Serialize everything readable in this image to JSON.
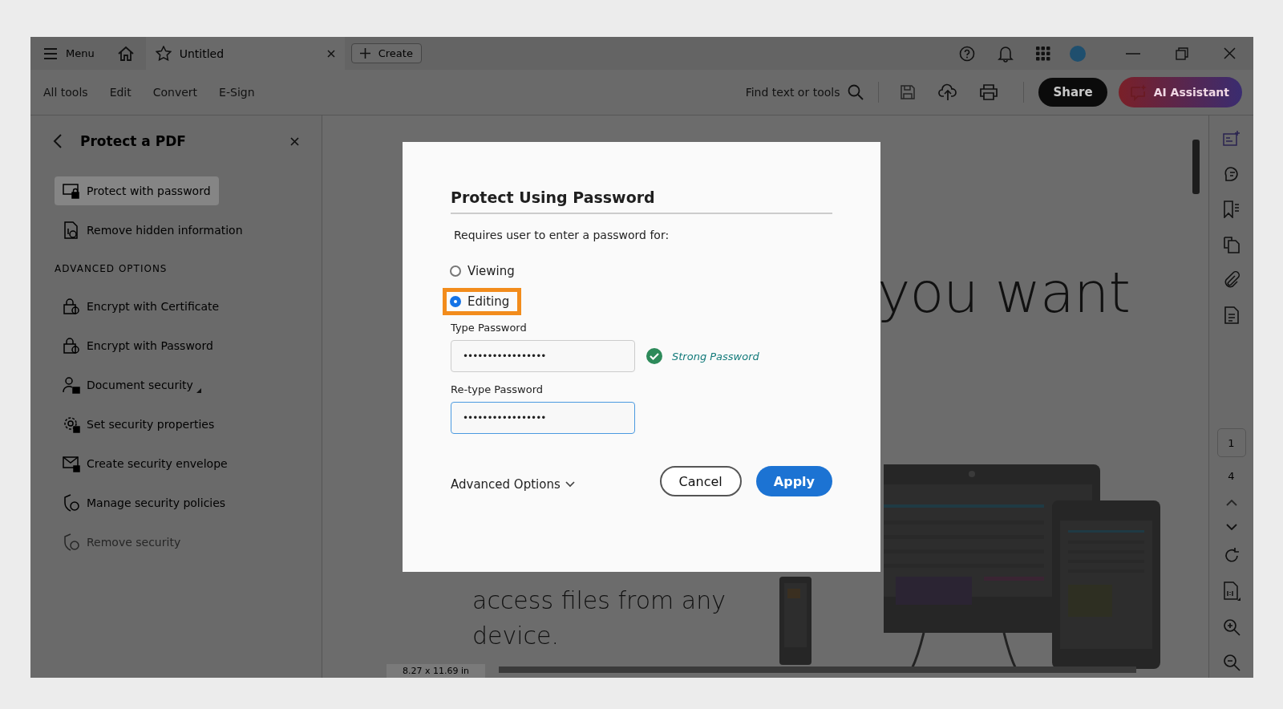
{
  "titlebar": {
    "menu_label": "Menu",
    "tab": {
      "title": "Untitled"
    },
    "create_label": "Create"
  },
  "toolbar": {
    "items": [
      {
        "label": "All tools"
      },
      {
        "label": "Edit"
      },
      {
        "label": "Convert"
      },
      {
        "label": "E-Sign"
      }
    ],
    "search_label": "Find text or tools",
    "share_label": "Share",
    "ai_label": "AI Assistant"
  },
  "sidebar": {
    "title": "Protect a PDF",
    "items": [
      {
        "label": "Protect with password",
        "selected": true,
        "disabled": false,
        "flyout": false
      },
      {
        "label": "Remove hidden information",
        "selected": false,
        "disabled": false,
        "flyout": false
      }
    ],
    "section_heading": "ADVANCED OPTIONS",
    "advanced_items": [
      {
        "label": "Encrypt with Certificate",
        "selected": false,
        "disabled": false,
        "flyout": false
      },
      {
        "label": "Encrypt with Password",
        "selected": false,
        "disabled": false,
        "flyout": false
      },
      {
        "label": "Document security",
        "selected": false,
        "disabled": false,
        "flyout": true
      },
      {
        "label": "Set security properties",
        "selected": false,
        "disabled": false,
        "flyout": false
      },
      {
        "label": "Create security envelope",
        "selected": false,
        "disabled": false,
        "flyout": false
      },
      {
        "label": "Manage security policies",
        "selected": false,
        "disabled": false,
        "flyout": false
      },
      {
        "label": "Remove security",
        "selected": false,
        "disabled": true,
        "flyout": false
      }
    ]
  },
  "document": {
    "heading_fragment": "you want",
    "body_lines": [
      "access files from any",
      "device."
    ],
    "page_size": "8.27 x 11.69 in"
  },
  "right_rail": {
    "page_current": "1",
    "page_total": "4"
  },
  "dialog": {
    "title": "Protect Using Password",
    "prompt": "Requires user to enter a password for:",
    "options": [
      {
        "label": "Viewing",
        "selected": false,
        "highlighted": false
      },
      {
        "label": "Editing",
        "selected": true,
        "highlighted": true
      }
    ],
    "fields": [
      {
        "label": "Type Password",
        "value": "•••••••••••••••••",
        "focused": false,
        "strength": "Strong Password"
      },
      {
        "label": "Re-type Password",
        "value": "•••••••••••••••••",
        "focused": true
      }
    ],
    "advanced_label": "Advanced Options",
    "buttons": [
      {
        "label": "Cancel",
        "kind": "secondary"
      },
      {
        "label": "Apply",
        "kind": "primary"
      }
    ]
  }
}
